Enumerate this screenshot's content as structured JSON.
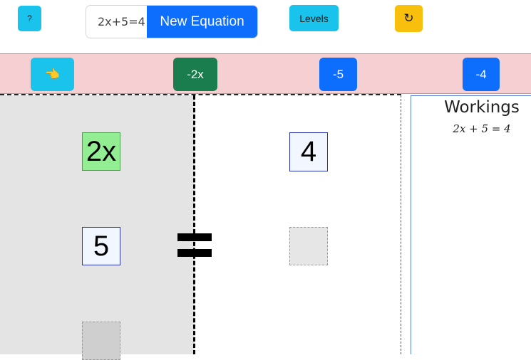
{
  "toolbar": {
    "help_label": "?",
    "equation_input_value": "2x+5=4",
    "new_equation_label": "New Equation",
    "levels_label": "Levels",
    "reset_icon": "↻"
  },
  "operations": {
    "hand_icon": "👈",
    "buttons": [
      {
        "label": "-2x"
      },
      {
        "label": "-5"
      },
      {
        "label": "-4"
      }
    ]
  },
  "equation": {
    "left_tiles": [
      "2x",
      "5"
    ],
    "right_tiles": [
      "4"
    ],
    "equals_sign": "="
  },
  "workings": {
    "title": "Workings",
    "lines": [
      "2x + 5 = 4"
    ]
  },
  "colors": {
    "info": "#19c3ec",
    "primary": "#0d6efd",
    "success": "#1a7d4d",
    "warning": "#f8bf0d",
    "ops_bar": "#f6cfd3",
    "variable_tile": "#93ee93"
  }
}
